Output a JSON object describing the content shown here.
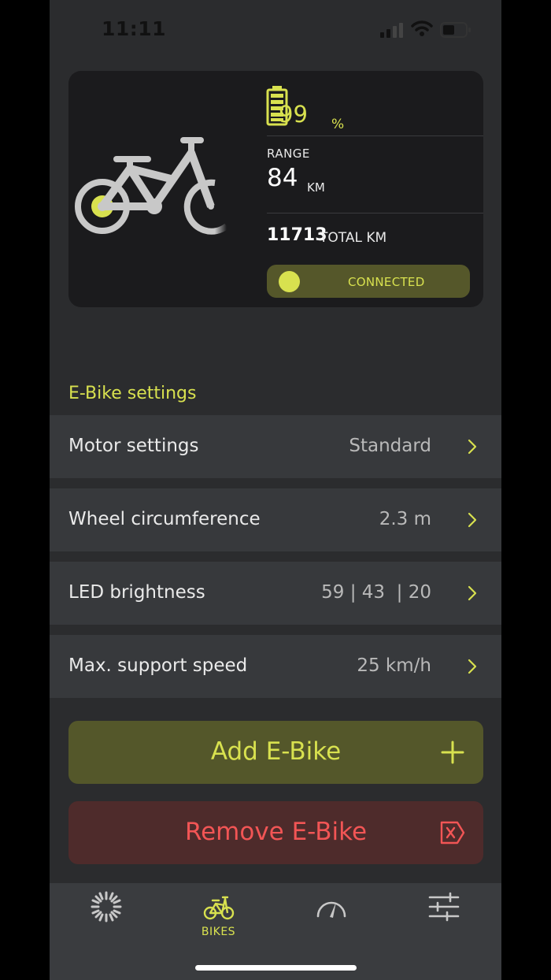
{
  "status_bar": {
    "time": "11:11"
  },
  "bike_card": {
    "battery_percent": "99",
    "battery_unit": "%",
    "range_label": "RANGE",
    "range_value": "84",
    "range_unit": "KM",
    "total_km_value": "11713",
    "total_km_label": "TOTAL KM",
    "connection_status": "CONNECTED"
  },
  "settings": {
    "section_title": "E-Bike settings",
    "rows": [
      {
        "label": "Motor settings",
        "value": "Standard"
      },
      {
        "label": "Wheel circumference",
        "value": "2.3 m"
      },
      {
        "label": "LED brightness",
        "value": "59 | 43  | 20"
      },
      {
        "label": "Max. support speed",
        "value": "25 km/h"
      }
    ]
  },
  "actions": {
    "add_label": "Add E-Bike",
    "remove_label": "Remove E-Bike"
  },
  "tab_bar": {
    "tabs": [
      {
        "icon": "loading-sun-icon",
        "label": ""
      },
      {
        "icon": "bike-icon",
        "label": "BIKES"
      },
      {
        "icon": "speedometer-icon",
        "label": ""
      },
      {
        "icon": "sliders-icon",
        "label": ""
      }
    ]
  },
  "colors": {
    "accent": "#d8e14f",
    "background": "#2b2c2e",
    "card": "#1b1b1d",
    "danger": "#f25555"
  }
}
